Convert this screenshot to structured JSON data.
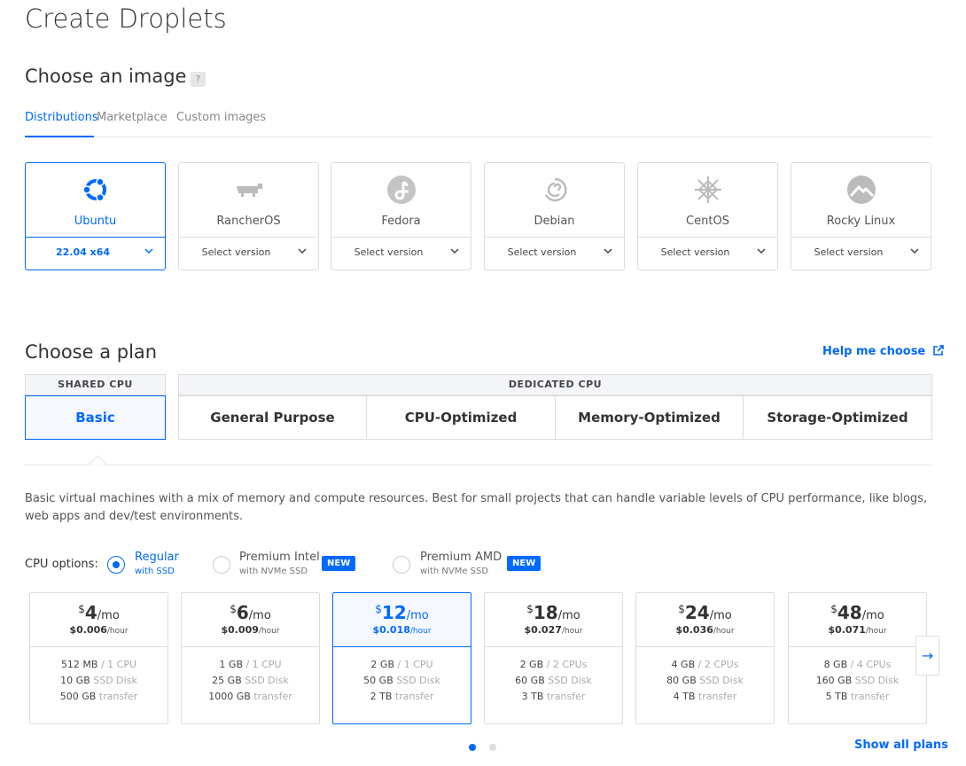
{
  "page": {
    "title": "Create Droplets"
  },
  "image_section": {
    "title": "Choose an image",
    "help": "?",
    "tabs": [
      "Distributions",
      "Marketplace",
      "Custom images"
    ],
    "distros": [
      {
        "name": "Ubuntu",
        "version": "22.04 x64",
        "icon": "ubuntu-logo",
        "selected": true
      },
      {
        "name": "RancherOS",
        "version": "Select version",
        "icon": "rancheros-logo"
      },
      {
        "name": "Fedora",
        "version": "Select version",
        "icon": "fedora-logo"
      },
      {
        "name": "Debian",
        "version": "Select version",
        "icon": "debian-logo"
      },
      {
        "name": "CentOS",
        "version": "Select version",
        "icon": "centos-logo"
      },
      {
        "name": "Rocky Linux",
        "version": "Select version",
        "icon": "rocky-linux-logo"
      }
    ]
  },
  "plan_section": {
    "title": "Choose a plan",
    "help_link": "Help me choose",
    "shared_label": "SHARED CPU",
    "dedicated_label": "DEDICATED CPU",
    "tabs": [
      "Basic",
      "General Purpose",
      "CPU-Optimized",
      "Memory-Optimized",
      "Storage-Optimized"
    ],
    "description": "Basic virtual machines with a mix of memory and compute resources. Best for small projects that can handle variable levels of CPU performance, like blogs, web apps and dev/test environments.",
    "cpu_options_label": "CPU options:",
    "cpu_options": [
      {
        "main": "Regular",
        "sub": "with SSD",
        "selected": true
      },
      {
        "main": "Premium Intel",
        "sub": "with NVMe SSD",
        "badge": "NEW"
      },
      {
        "main": "Premium AMD",
        "sub": "with NVMe SSD",
        "badge": "NEW"
      }
    ],
    "prices": [
      {
        "currency": "$",
        "amount": "4",
        "per": "/mo",
        "hourly": "$0.006",
        "hour_unit": "/hour",
        "mem": "512 MB",
        "cpu": "/ 1 CPU",
        "disk": "10 GB",
        "disk_label": "SSD Disk",
        "transfer": "500 GB",
        "transfer_label": "transfer"
      },
      {
        "currency": "$",
        "amount": "6",
        "per": "/mo",
        "hourly": "$0.009",
        "hour_unit": "/hour",
        "mem": "1 GB",
        "cpu": "/ 1 CPU",
        "disk": "25 GB",
        "disk_label": "SSD Disk",
        "transfer": "1000 GB",
        "transfer_label": "transfer"
      },
      {
        "currency": "$",
        "amount": "12",
        "per": "/mo",
        "hourly": "$0.018",
        "hour_unit": "/hour",
        "mem": "2 GB",
        "cpu": "/ 1 CPU",
        "disk": "50 GB",
        "disk_label": "SSD Disk",
        "transfer": "2 TB",
        "transfer_label": "transfer",
        "selected": true
      },
      {
        "currency": "$",
        "amount": "18",
        "per": "/mo",
        "hourly": "$0.027",
        "hour_unit": "/hour",
        "mem": "2 GB",
        "cpu": "/ 2 CPUs",
        "disk": "60 GB",
        "disk_label": "SSD Disk",
        "transfer": "3 TB",
        "transfer_label": "transfer"
      },
      {
        "currency": "$",
        "amount": "24",
        "per": "/mo",
        "hourly": "$0.036",
        "hour_unit": "/hour",
        "mem": "4 GB",
        "cpu": "/ 2 CPUs",
        "disk": "80 GB",
        "disk_label": "SSD Disk",
        "transfer": "4 TB",
        "transfer_label": "transfer"
      },
      {
        "currency": "$",
        "amount": "48",
        "per": "/mo",
        "hourly": "$0.071",
        "hour_unit": "/hour",
        "mem": "8 GB",
        "cpu": "/ 4 CPUs",
        "disk": "160 GB",
        "disk_label": "SSD Disk",
        "transfer": "5 TB",
        "transfer_label": "transfer"
      }
    ],
    "next_arrow": "→",
    "show_all": "Show all plans"
  },
  "colors": {
    "accent": "#0069ff",
    "border": "#dddddd"
  }
}
